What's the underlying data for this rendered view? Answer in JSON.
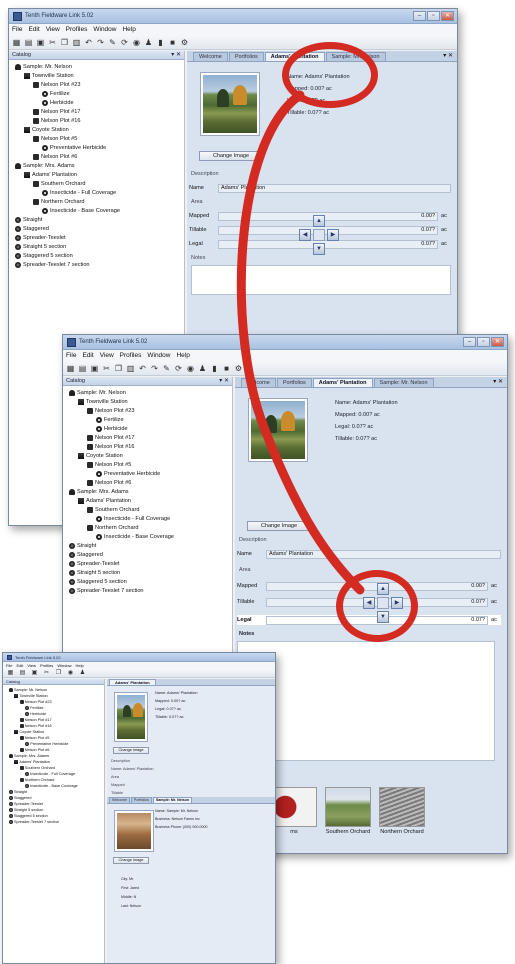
{
  "app": {
    "title": "Tenth Fieldware Link 5.02",
    "menu": [
      "File",
      "Edit",
      "View",
      "Profiles",
      "Window",
      "Help"
    ],
    "window_buttons": [
      "–",
      "▫",
      "✕"
    ]
  },
  "catalog": {
    "title": "Catalog",
    "pin": "▾ ✕",
    "items": [
      {
        "label": "Sample: Mr. Nelson",
        "level": 0,
        "icon": "person-icon"
      },
      {
        "label": "Townville Station",
        "level": 1,
        "icon": "farm-icon"
      },
      {
        "label": "Nelson Plot #23",
        "level": 2,
        "icon": "folder-icon"
      },
      {
        "label": "Fertilize",
        "level": 3,
        "icon": "disc-icon"
      },
      {
        "label": "Herbicide",
        "level": 3,
        "icon": "disc-icon"
      },
      {
        "label": "Nelson Plot #17",
        "level": 2,
        "icon": "folder-icon"
      },
      {
        "label": "Nelson Plot #16",
        "level": 2,
        "icon": "folder-icon"
      },
      {
        "label": "Coyote Station",
        "level": 1,
        "icon": "farm-icon"
      },
      {
        "label": "Nelson Plot #5",
        "level": 2,
        "icon": "folder-icon"
      },
      {
        "label": "Preventative Herbicide",
        "level": 3,
        "icon": "disc-icon"
      },
      {
        "label": "Nelson Plot #6",
        "level": 2,
        "icon": "folder-icon"
      },
      {
        "label": "Sample: Mrs. Adams",
        "level": 0,
        "icon": "person-icon"
      },
      {
        "label": "Adams' Plantation",
        "level": 1,
        "icon": "farm-icon"
      },
      {
        "label": "Southern Orchard",
        "level": 2,
        "icon": "folder-icon"
      },
      {
        "label": "Insecticide - Full Coverage",
        "level": 3,
        "icon": "disc-icon"
      },
      {
        "label": "Northern Orchard",
        "level": 2,
        "icon": "folder-icon"
      },
      {
        "label": "Insecticide - Base Coverage",
        "level": 3,
        "icon": "disc-icon"
      },
      {
        "label": "Straight",
        "level": 0,
        "icon": "gear-icon"
      },
      {
        "label": "Staggered",
        "level": 0,
        "icon": "gear-icon"
      },
      {
        "label": "Spreader-Teeslet",
        "level": 0,
        "icon": "gear-icon"
      },
      {
        "label": "Straight 5 section",
        "level": 0,
        "icon": "gear-icon"
      },
      {
        "label": "Staggered 5 section",
        "level": 0,
        "icon": "gear-icon"
      },
      {
        "label": "Spreader-Teeslet 7 section",
        "level": 0,
        "icon": "gear-icon"
      }
    ]
  },
  "tabs": [
    "Welcome",
    "Portfolios",
    "Adams' Plantation",
    "Sample: Mr. Nelson"
  ],
  "tab_close": "▾ ✕",
  "details": {
    "name_line": "Name: Adams' Plantation",
    "mapped_line": "Mapped: 0.00? ac",
    "legal_line": "Legal: 0.07? ac",
    "tillable_line": "Tillable: 0.07? ac",
    "change_image": "Change Image",
    "description_label": "Description",
    "name_label": "Name",
    "name_value": "Adams' Plantation",
    "area_label": "Area",
    "mapped_label": "Mapped",
    "mapped_value": "0.00?",
    "tillable_label": "Tillable",
    "tillable_value": "0.07?",
    "legal_label": "Legal",
    "legal_value": "0.07?",
    "unit": "ac",
    "notes_label": "Notes"
  },
  "nav": {
    "up": "▲",
    "left": "◀",
    "right": "▶",
    "down": "▼"
  },
  "thumbnails": [
    {
      "label": "ms"
    },
    {
      "label": "Southern Orchard"
    },
    {
      "label": "Northern Orchard"
    }
  ],
  "small_panel": {
    "tab_label": "Adams' Plantation",
    "second_tabs": [
      "Welcome",
      "Portfolios",
      "Sample: Mr. Nelson"
    ],
    "person_name": "Name: Sample: Mr. Nelson",
    "business": "Business: Nelson Farms Inc",
    "phone": "Business Phone: (000) 000-0000",
    "change_image": "Change Image",
    "fields": [
      "City: Mr.",
      "First: Jared",
      "Middle: N",
      "Last: Nelson"
    ]
  },
  "colors": {
    "accent_red": "#d32a22",
    "title_blue": "#a9c1e2"
  }
}
